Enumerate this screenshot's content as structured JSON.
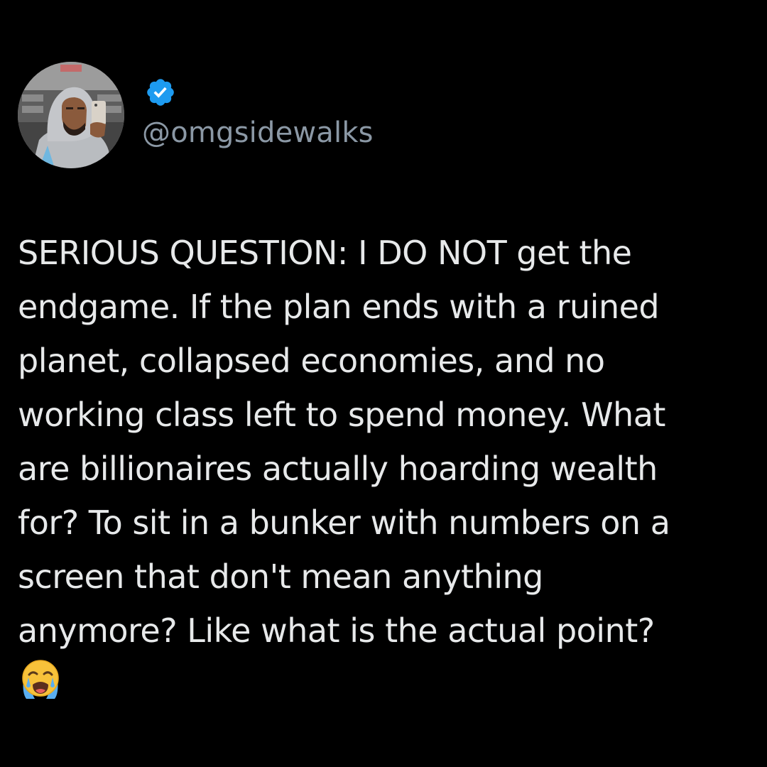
{
  "post": {
    "author": {
      "handle": "@omgsidewalks",
      "verified": true,
      "avatar_icon": "profile-photo",
      "badge_icon": "verified-badge-icon"
    },
    "text": "SERIOUS QUESTION: I DO NOT get the\nendgame. If the plan ends with a ruined\nplanet, collapsed economies, and no\nworking class left to spend money. What\nare billionaires actually hoarding wealth\nfor? To sit in a bunker with numbers on a\nscreen that don't mean anything\nanymore? Like what is the actual point?",
    "emoji": "😭",
    "emoji_icon": "loudly-crying-face-icon"
  },
  "colors": {
    "background": "#000000",
    "text": "#e7e9ea",
    "handle": "#8b98a5",
    "verified_badge": "#1d9bf0"
  }
}
